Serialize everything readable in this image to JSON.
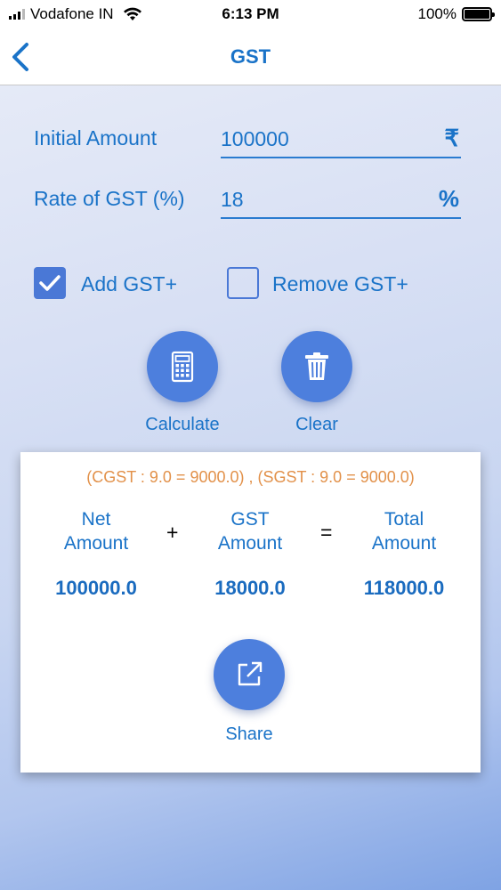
{
  "status_bar": {
    "carrier": "Vodafone IN",
    "time": "6:13 PM",
    "battery": "100%"
  },
  "nav": {
    "title": "GST"
  },
  "form": {
    "initial_amount": {
      "label": "Initial Amount",
      "value": "100000",
      "suffix": "₹"
    },
    "gst_rate": {
      "label": "Rate of GST (%)",
      "value": "18",
      "suffix": "%"
    }
  },
  "options": {
    "add_gst": {
      "label": "Add GST+",
      "checked": true
    },
    "remove_gst": {
      "label": "Remove GST+",
      "checked": false
    }
  },
  "actions": {
    "calculate_label": "Calculate",
    "clear_label": "Clear"
  },
  "result": {
    "breakdown": "(CGST : 9.0 = 9000.0) , (SGST : 9.0 = 9000.0)",
    "net_label_line1": "Net",
    "net_label_line2": "Amount",
    "gst_label_line1": "GST",
    "gst_label_line2": "Amount",
    "total_label_line1": "Total",
    "total_label_line2": "Amount",
    "plus": "+",
    "equals": "=",
    "net_value": "100000.0",
    "gst_value": "18000.0",
    "total_value": "118000.0",
    "share_label": "Share"
  },
  "colors": {
    "accent": "#1a73c8",
    "button": "#4d7fdd",
    "breakdown": "#e2914a"
  }
}
